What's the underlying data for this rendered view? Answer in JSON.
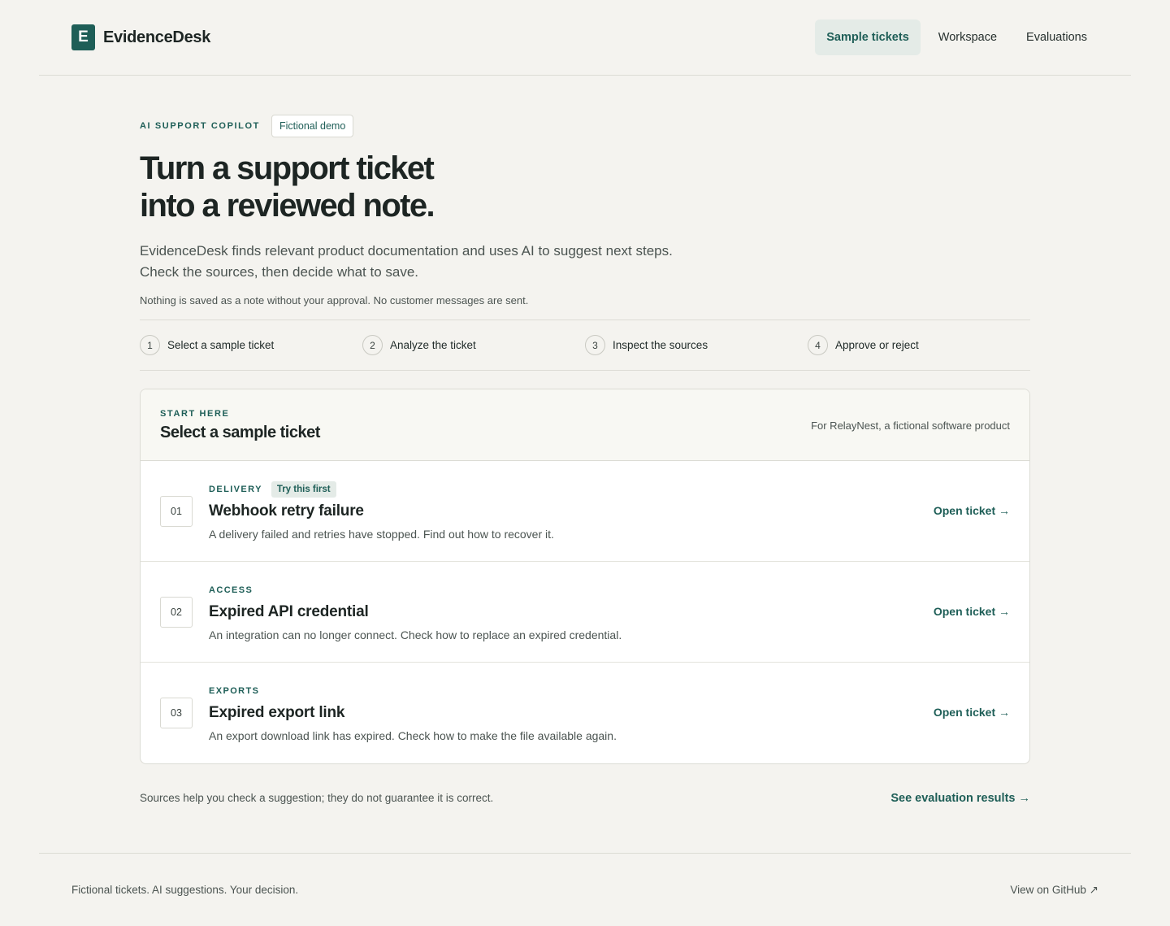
{
  "header": {
    "brand_mark": "E",
    "brand_name": "EvidenceDesk",
    "nav": [
      {
        "label": "Sample tickets",
        "active": true
      },
      {
        "label": "Workspace",
        "active": false
      },
      {
        "label": "Evaluations",
        "active": false
      }
    ]
  },
  "hero": {
    "eyebrow": "AI SUPPORT COPILOT",
    "pill": "Fictional demo",
    "title_line1": "Turn a support ticket",
    "title_line2": "into a reviewed note.",
    "subtitle_line1": "EvidenceDesk finds relevant product documentation and uses AI to suggest next steps.",
    "subtitle_line2": "Check the sources, then decide what to save.",
    "note": "Nothing is saved as a note without your approval. No customer messages are sent."
  },
  "steps": [
    {
      "num": "1",
      "label": "Select a sample ticket"
    },
    {
      "num": "2",
      "label": "Analyze the ticket"
    },
    {
      "num": "3",
      "label": "Inspect the sources"
    },
    {
      "num": "4",
      "label": "Approve or reject"
    }
  ],
  "card": {
    "eyebrow": "START HERE",
    "title": "Select a sample ticket",
    "aside": "For RelayNest, a fictional software product",
    "tickets": [
      {
        "num": "01",
        "category": "DELIVERY",
        "badge": "Try this first",
        "title": "Webhook retry failure",
        "description": "A delivery failed and retries have stopped. Find out how to recover it.",
        "link": "Open ticket →"
      },
      {
        "num": "02",
        "category": "ACCESS",
        "badge": "",
        "title": "Expired API credential",
        "description": "An integration can no longer connect. Check how to replace an expired credential.",
        "link": "Open ticket →"
      },
      {
        "num": "03",
        "category": "EXPORTS",
        "badge": "",
        "title": "Expired export link",
        "description": "An export download link has expired. Check how to make the file available again.",
        "link": "Open ticket →"
      }
    ]
  },
  "disclaimer": "Sources help you check a suggestion; they do not guarantee it is correct.",
  "eval_link": "See evaluation results →",
  "footer": {
    "left": "Fictional tickets. AI suggestions. Your decision.",
    "right": "View on GitHub ↗"
  },
  "colors": {
    "accent": "#1e5e57",
    "background": "#f4f3ef",
    "text": "#1d2523"
  }
}
